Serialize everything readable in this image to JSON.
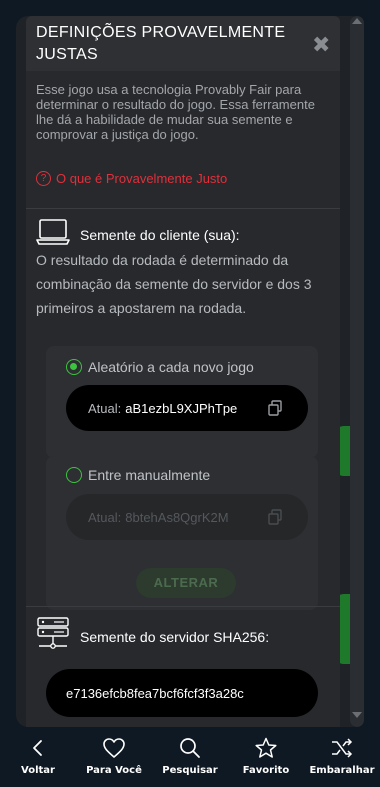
{
  "modal": {
    "title": "DEFINIÇÕES PROVAVELMENTE JUSTAS",
    "close_label": "✖",
    "intro": "Esse jogo usa a tecnologia Provably Fair para determinar o resultado do jogo. Essa ferramente lhe dá a habilidade de mudar sua semente e comprovar a justiça do jogo.",
    "pf_link": "O que é Provavelmente Justo",
    "pf_icon": "?"
  },
  "client_seed": {
    "heading": "Semente do cliente (sua):",
    "description": "O resultado da rodada é determinado da combinação da semente do servidor e dos 3 primeiros a apostarem na rodada.",
    "random_option": {
      "label": "Aleatório a cada novo jogo",
      "prefix": "Atual:",
      "value": "aB1ezbL9XJPhTpe"
    },
    "manual_option": {
      "label": "Entre manualmente",
      "prefix": "Atual:",
      "value": "8btehAs8QgrK2M"
    },
    "change_button": "ALTERAR"
  },
  "server_seed": {
    "heading": "Semente do servidor SHA256:",
    "value": "e7136efcb8fea7bcf6fcf3f3a28c"
  },
  "nav": [
    {
      "label": "Voltar",
      "icon": "chevron-left-icon"
    },
    {
      "label": "Para Você",
      "icon": "heart-icon"
    },
    {
      "label": "Pesquisar",
      "icon": "search-icon"
    },
    {
      "label": "Favorito",
      "icon": "star-icon"
    },
    {
      "label": "Embaralhar",
      "icon": "shuffle-icon"
    }
  ],
  "colors": {
    "accent_green": "#3bc43e",
    "link_red": "#e0303b",
    "modal_bg": "#27292d",
    "page_bg": "#0f1923"
  }
}
